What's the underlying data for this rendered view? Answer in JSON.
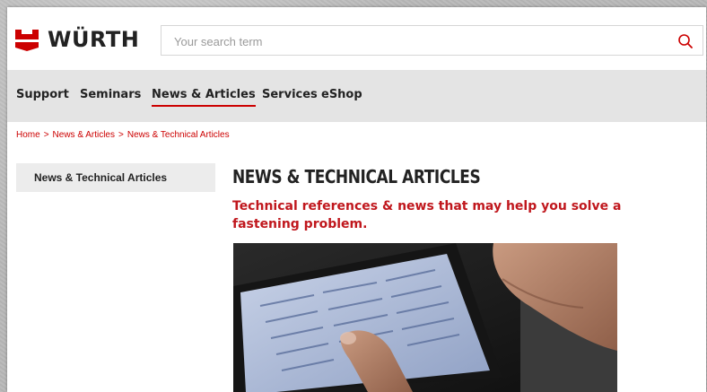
{
  "header": {
    "brand": "WÜRTH",
    "search_placeholder": "Your search term"
  },
  "nav": {
    "items": [
      {
        "label": "Support"
      },
      {
        "label": "Seminars"
      },
      {
        "label": "News & Articles",
        "active": true
      },
      {
        "label": "Services"
      },
      {
        "label": "eShop"
      }
    ]
  },
  "breadcrumb": {
    "items": [
      "Home",
      "News & Articles",
      "News & Technical Articles"
    ],
    "separator": ">"
  },
  "sidebar": {
    "items": [
      {
        "label": "News & Technical Articles"
      }
    ]
  },
  "main": {
    "title": "NEWS & TECHNICAL ARTICLES",
    "subtitle": "Technical references & news that may help you solve a fastening problem."
  },
  "icons": {
    "logo": "wurth-logo-icon",
    "search": "search-icon"
  },
  "colors": {
    "brand_red": "#cc0000",
    "subtitle_red": "#c0171d",
    "nav_bg": "#e4e4e4",
    "sidebar_bg": "#ececec"
  }
}
